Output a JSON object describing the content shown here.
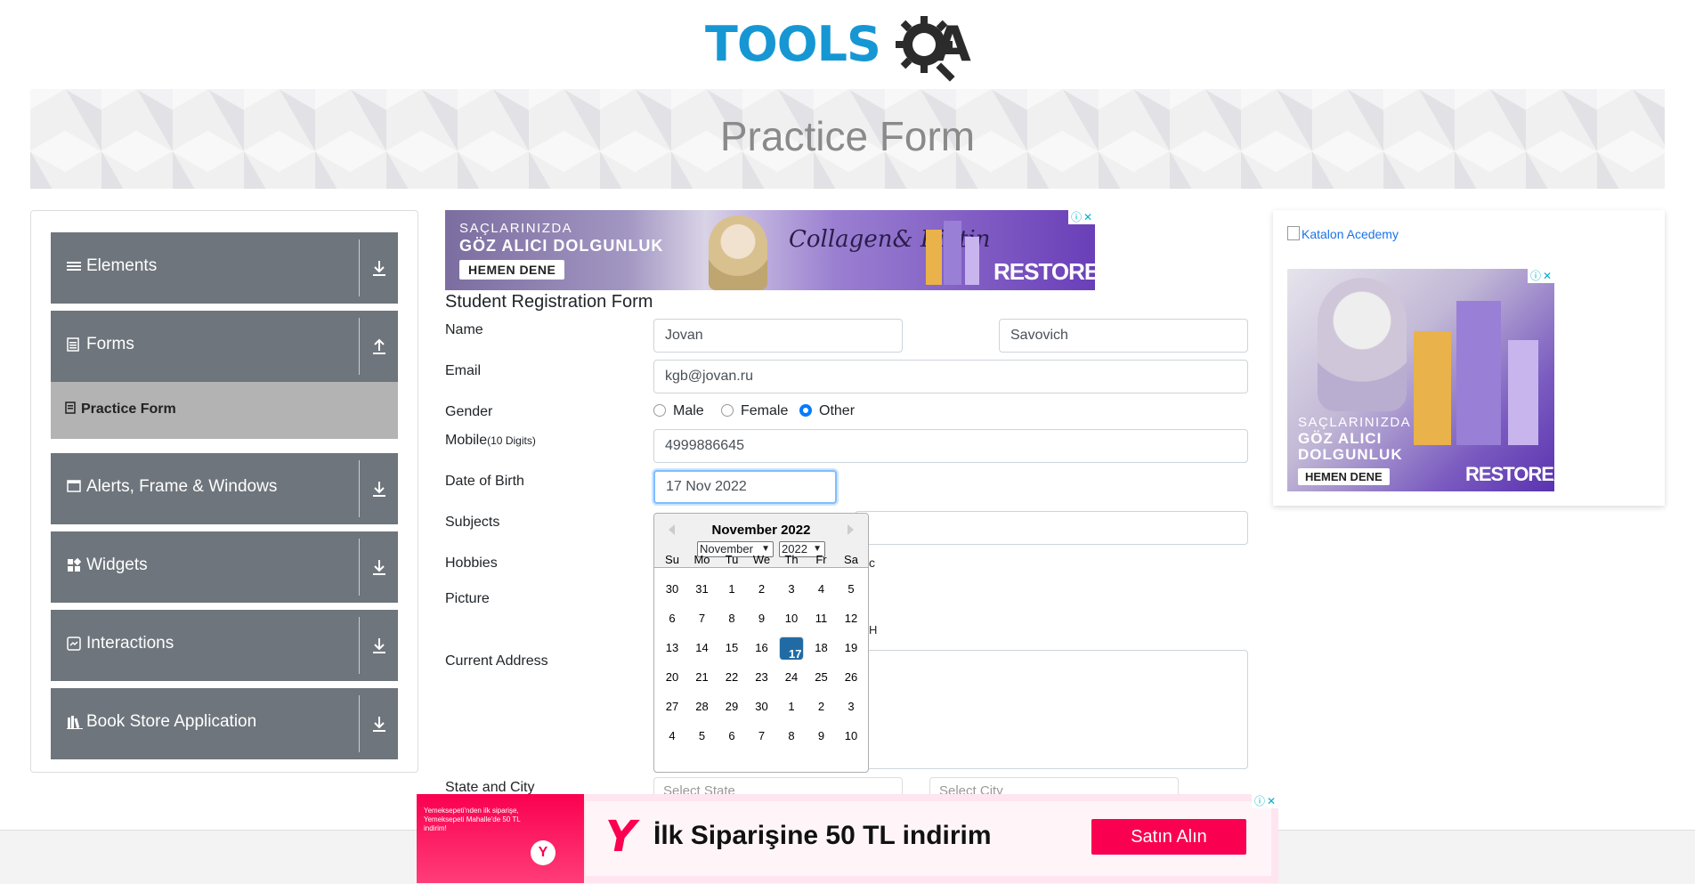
{
  "header": {
    "logo_text_tools": "TOOLS",
    "logo_text_qa": "QA",
    "page_title": "Practice Form"
  },
  "sidebar": {
    "groups": [
      {
        "label": "Elements",
        "icon": "list-icon",
        "arrow": "download-arrow-icon"
      },
      {
        "label": "Forms",
        "icon": "form-icon",
        "arrow": "upload-arrow-icon"
      },
      {
        "label": "Alerts, Frame & Windows",
        "icon": "window-icon",
        "arrow": "download-arrow-icon"
      },
      {
        "label": "Widgets",
        "icon": "widgets-icon",
        "arrow": "download-arrow-icon"
      },
      {
        "label": "Interactions",
        "icon": "interactions-icon",
        "arrow": "download-arrow-icon"
      },
      {
        "label": "Book Store Application",
        "icon": "books-icon",
        "arrow": "download-arrow-icon"
      }
    ],
    "active_item": "Practice Form"
  },
  "ads": {
    "top": {
      "line1": "SAÇLARINIZDA",
      "line2": "GÖZ ALICI DOLGUNLUK",
      "cta": "HEMEN DENE",
      "script": "Collagen& Biotin",
      "brand": "RESTOREX"
    },
    "right": {
      "broken_image": "Katalon Acedemy",
      "line1": "SAÇLARINIZDA",
      "line2": "GÖZ ALICI DOLGUNLUK",
      "cta": "HEMEN DENE",
      "brand": "RESTOREX"
    },
    "bottom": {
      "small_text": "Yemeksepeti'nden ilk siparişe, Yemeksepeti Mahalle'de 50 TL indirim!",
      "logo": "Y",
      "message": "İlk Siparişine 50 TL indirim",
      "button": "Satın Alın"
    }
  },
  "form": {
    "title": "Student Registration Form",
    "labels": {
      "name": "Name",
      "email": "Email",
      "gender": "Gender",
      "mobile": "Mobile",
      "mobile_hint": "(10 Digits)",
      "dob": "Date of Birth",
      "subjects": "Subjects",
      "hobbies": "Hobbies",
      "picture": "Picture",
      "address": "Current Address",
      "state_city": "State and City"
    },
    "values": {
      "first_name": "Jovan",
      "last_name": "Savovich",
      "email": "kgb@jovan.ru",
      "mobile": "4999886645",
      "dob": "17 Nov 2022",
      "address": ""
    },
    "gender_options": [
      "Male",
      "Female",
      "Other"
    ],
    "gender_selected": "Other",
    "hobbies_tail": "c",
    "picture_tail": "H",
    "state_placeholder": "Select State",
    "city_placeholder": "Select City"
  },
  "datepicker": {
    "title": "November 2022",
    "month_select": "November",
    "year_select": "2022",
    "day_names": [
      "Su",
      "Mo",
      "Tu",
      "We",
      "Th",
      "Fr",
      "Sa"
    ],
    "weeks": [
      [
        "30",
        "31",
        "1",
        "2",
        "3",
        "4",
        "5"
      ],
      [
        "6",
        "7",
        "8",
        "9",
        "10",
        "11",
        "12"
      ],
      [
        "13",
        "14",
        "15",
        "16",
        "17",
        "18",
        "19"
      ],
      [
        "20",
        "21",
        "22",
        "23",
        "24",
        "25",
        "26"
      ],
      [
        "27",
        "28",
        "29",
        "30",
        "1",
        "2",
        "3"
      ],
      [
        "4",
        "5",
        "6",
        "7",
        "8",
        "9",
        "10"
      ]
    ],
    "selected_day": "17"
  },
  "colors": {
    "sidebar_group": "#6e757c",
    "sidebar_active": "#b3b3b3",
    "logo_blue": "#1697d4",
    "selected_day": "#216ba5",
    "ad_pink": "#fa0050"
  }
}
